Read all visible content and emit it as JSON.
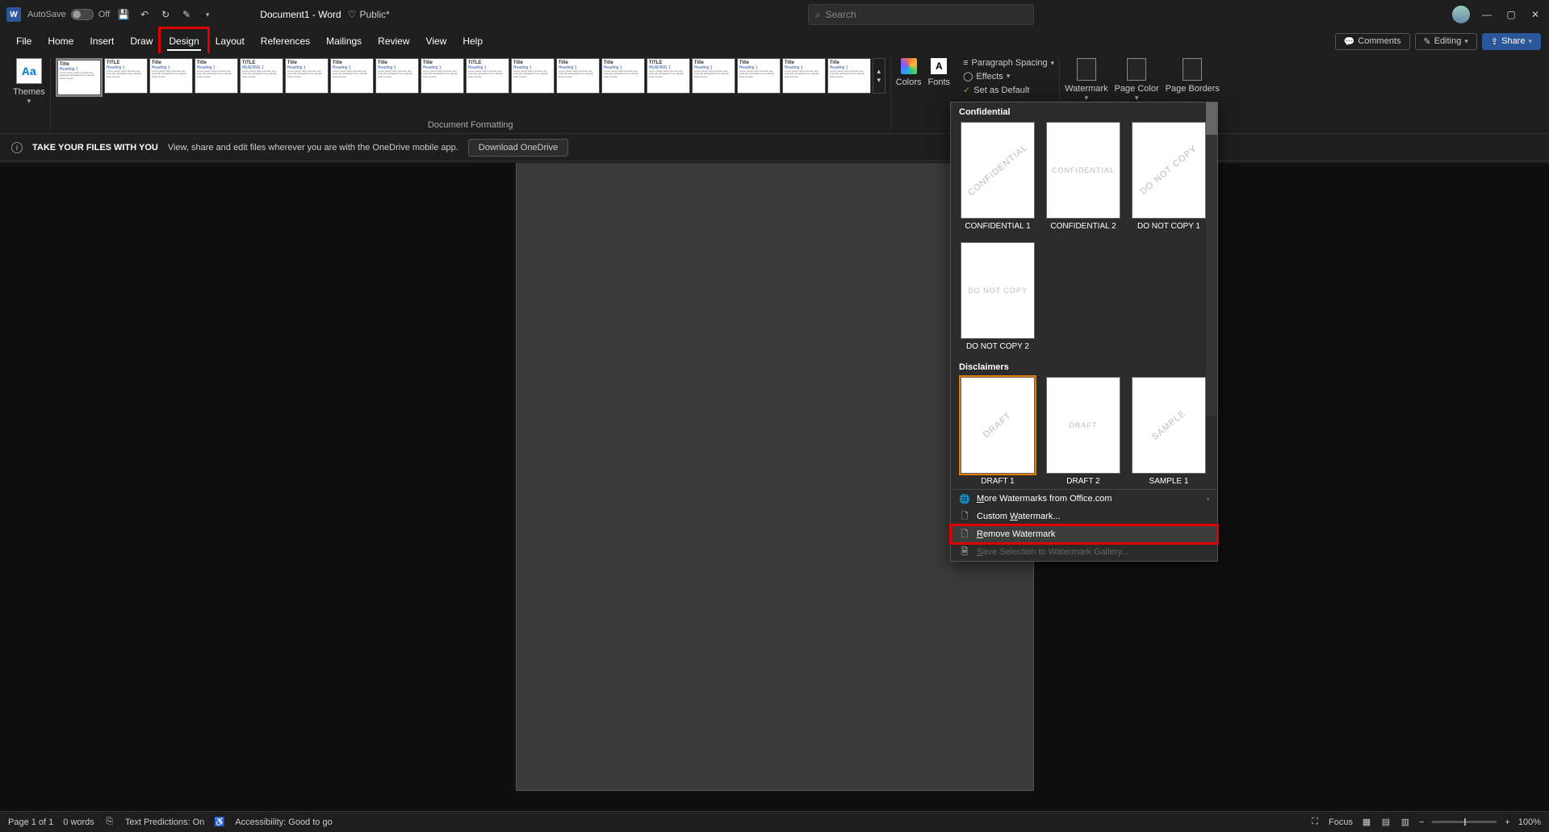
{
  "titlebar": {
    "autosave_label": "AutoSave",
    "autosave_state": "Off",
    "doc_name": "Document1 - Word",
    "sensitivity": "Public*",
    "search_placeholder": "Search"
  },
  "tabs": {
    "items": [
      "File",
      "Home",
      "Insert",
      "Draw",
      "Design",
      "Layout",
      "References",
      "Mailings",
      "Review",
      "View",
      "Help"
    ],
    "active_index": 4,
    "comments": "Comments",
    "editing": "Editing",
    "share": "Share"
  },
  "ribbon": {
    "themes_label": "Themes",
    "doc_formatting_label": "Document Formatting",
    "colors_label": "Colors",
    "fonts_label": "Fonts",
    "paragraph_spacing": "Paragraph Spacing",
    "effects": "Effects",
    "set_default": "Set as Default",
    "watermark": "Watermark",
    "page_color": "Page Color",
    "page_borders": "Page Borders",
    "style_thumbs": [
      {
        "title": "Title",
        "heading": "Heading 1"
      },
      {
        "title": "TITLE",
        "heading": "Heading 1"
      },
      {
        "title": "Title",
        "heading": "Heading 1"
      },
      {
        "title": "Title",
        "heading": "Heading 1"
      },
      {
        "title": "TITLE",
        "heading": "HEADING 1"
      },
      {
        "title": "Title",
        "heading": "Heading 1"
      },
      {
        "title": "Title",
        "heading": "Heading 1"
      },
      {
        "title": "Title",
        "heading": "Heading 1"
      },
      {
        "title": "Title",
        "heading": "Heading 1"
      },
      {
        "title": "TITLE",
        "heading": "Heading 1"
      },
      {
        "title": "Title",
        "heading": "Heading 1"
      },
      {
        "title": "Title",
        "heading": "Heading 1"
      },
      {
        "title": "Title",
        "heading": "Heading 1"
      },
      {
        "title": "TITLE",
        "heading": "HEADING 1"
      },
      {
        "title": "Title",
        "heading": "Heading 1"
      },
      {
        "title": "Title",
        "heading": "Heading 1"
      },
      {
        "title": "Title",
        "heading": "Heading 1"
      },
      {
        "title": "Title",
        "heading": "Heading 1"
      }
    ]
  },
  "infobar": {
    "title": "TAKE YOUR FILES WITH YOU",
    "text": "View, share and edit files wherever you are with the OneDrive mobile app.",
    "button": "Download OneDrive"
  },
  "watermark_panel": {
    "section1": "Confidential",
    "section2": "Disclaimers",
    "items1": [
      {
        "text": "CONFIDENTIAL",
        "label": "CONFIDENTIAL 1",
        "diag": true
      },
      {
        "text": "CONFIDENTIAL",
        "label": "CONFIDENTIAL 2",
        "diag": false
      },
      {
        "text": "DO NOT COPY",
        "label": "DO NOT COPY 1",
        "diag": true
      },
      {
        "text": "DO NOT COPY",
        "label": "DO NOT COPY 2",
        "diag": false
      }
    ],
    "items2": [
      {
        "text": "DRAFT",
        "label": "DRAFT 1",
        "diag": true,
        "selected": true
      },
      {
        "text": "DRAFT",
        "label": "DRAFT 2",
        "diag": false
      },
      {
        "text": "SAMPLE",
        "label": "SAMPLE 1",
        "diag": true
      }
    ],
    "menu": {
      "more": "More Watermarks from Office.com",
      "custom": "Custom Watermark...",
      "remove": "Remove Watermark",
      "save": "Save Selection to Watermark Gallery..."
    }
  },
  "statusbar": {
    "page": "Page 1 of 1",
    "words": "0 words",
    "predictions": "Text Predictions: On",
    "accessibility": "Accessibility: Good to go",
    "focus": "Focus",
    "zoom": "100%"
  }
}
